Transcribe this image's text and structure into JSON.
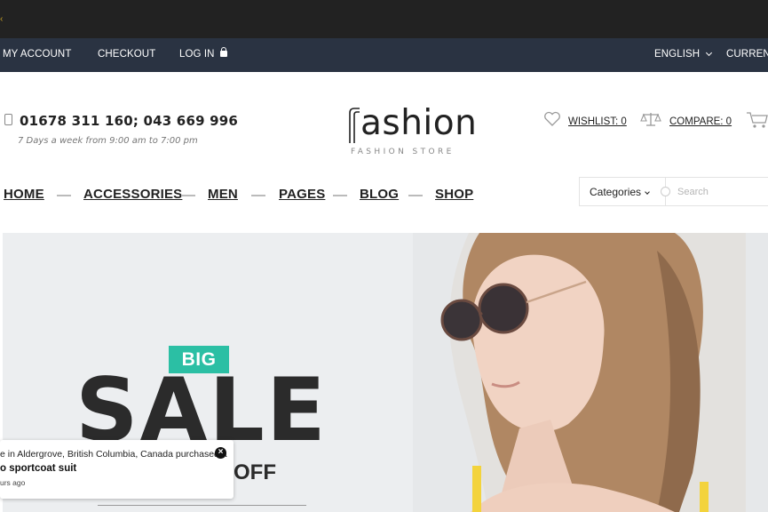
{
  "topbar": {
    "my_account": "MY ACCOUNT",
    "checkout": "CHECKOUT",
    "login": "LOG IN",
    "language": "ENGLISH",
    "currency": "CURRENC"
  },
  "header": {
    "phone": "01678 311 160; 043 669 996",
    "hours": "7 Days a week from 9:00 am to 7:00 pm",
    "logo_text": "ashion",
    "logo_sub": "FASHION STORE",
    "wishlist": "WISHLIST: 0",
    "compare": "COMPARE: 0"
  },
  "nav": {
    "items": [
      "HOME",
      "ACCESSORIES",
      "MEN",
      "PAGES",
      "BLOG",
      "SHOP"
    ]
  },
  "search": {
    "category": "Categories",
    "placeholder": "Search"
  },
  "hero": {
    "badge": "BIG",
    "headline": "SALE",
    "off": "OFF"
  },
  "toast": {
    "line1": "e in Aldergrove, British Columbia, Canada purchased a",
    "line2": "o sportcoat suit",
    "line3": "urs ago",
    "close": "×"
  },
  "colors": {
    "topbar_bg": "#2a3342",
    "accent": "#2bbfa4",
    "dark": "#222222"
  }
}
